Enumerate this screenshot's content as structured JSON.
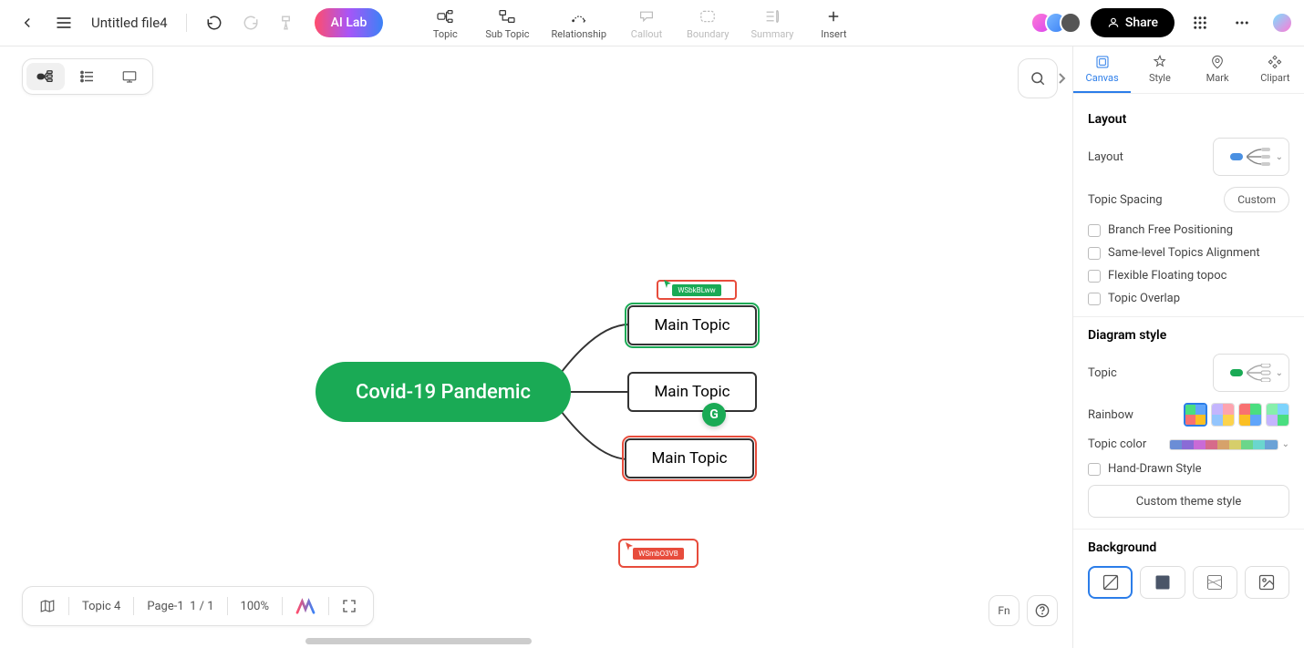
{
  "header": {
    "file_title": "Untitled file4",
    "ai_lab": "AI Lab",
    "share": "Share",
    "tools": [
      {
        "label": "Topic",
        "icon": "topic-icon",
        "disabled": false
      },
      {
        "label": "Sub Topic",
        "icon": "subtopic-icon",
        "disabled": false
      },
      {
        "label": "Relationship",
        "icon": "relationship-icon",
        "disabled": false
      },
      {
        "label": "Callout",
        "icon": "callout-icon",
        "disabled": true
      },
      {
        "label": "Boundary",
        "icon": "boundary-icon",
        "disabled": true
      },
      {
        "label": "Summary",
        "icon": "summary-icon",
        "disabled": true
      },
      {
        "label": "Insert",
        "icon": "insert-icon",
        "disabled": false
      }
    ]
  },
  "canvas": {
    "central_topic": "Covid-19 Pandemic",
    "main_topics": [
      {
        "text": "Main Topic",
        "selected": "green"
      },
      {
        "text": "Main Topic",
        "selected": null
      },
      {
        "text": "Main Topic",
        "selected": "red"
      }
    ],
    "user_labels": {
      "top": "WSbkBLww",
      "bottom": "WSmbO3VB"
    },
    "badge": "G"
  },
  "right_panel": {
    "tabs": [
      {
        "label": "Canvas",
        "active": true
      },
      {
        "label": "Style",
        "active": false
      },
      {
        "label": "Mark",
        "active": false
      },
      {
        "label": "Clipart",
        "active": false
      }
    ],
    "layout": {
      "title": "Layout",
      "layout_label": "Layout",
      "spacing_label": "Topic Spacing",
      "spacing_value": "Custom",
      "checks": [
        "Branch Free Positioning",
        "Same-level Topics Alignment",
        "Flexible Floating topoc",
        "Topic Overlap"
      ]
    },
    "diagram_style": {
      "title": "Diagram style",
      "topic_label": "Topic",
      "rainbow_label": "Rainbow",
      "topic_color_label": "Topic color",
      "hand_drawn": "Hand-Drawn Style",
      "custom_theme": "Custom theme style"
    },
    "background": {
      "title": "Background"
    },
    "topic_colors": [
      "#6b8dd6",
      "#8a6bd6",
      "#c96bd6",
      "#d66b8a",
      "#d6a26b",
      "#d6ce6b",
      "#6bd68a",
      "#6bd6ce",
      "#6ba2d6"
    ]
  },
  "bottom_bar": {
    "topic_count": "Topic 4",
    "page": "Page-1",
    "page_nav": "1 / 1",
    "zoom": "100%",
    "fn": "Fn"
  }
}
